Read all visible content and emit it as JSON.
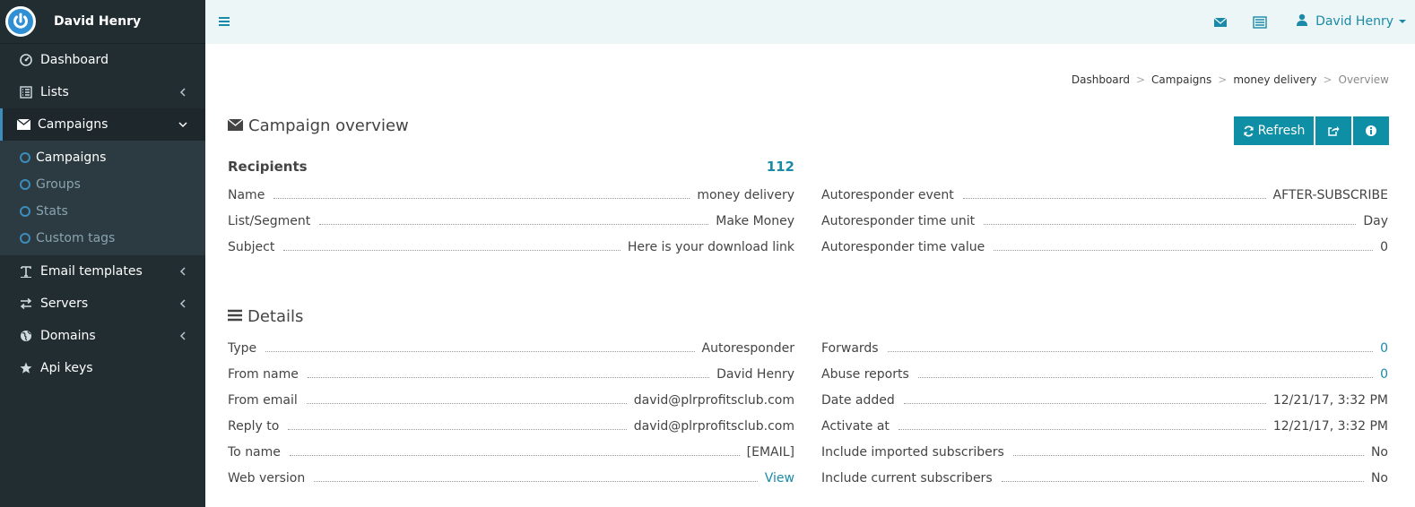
{
  "sidebar": {
    "brand_name": "David Henry",
    "items": [
      {
        "label": "Dashboard",
        "icon": "dashboard-icon"
      },
      {
        "label": "Lists",
        "icon": "list-icon"
      },
      {
        "label": "Campaigns",
        "icon": "envelope-icon"
      },
      {
        "label": "Email templates",
        "icon": "text-icon"
      },
      {
        "label": "Servers",
        "icon": "exchange-icon"
      },
      {
        "label": "Domains",
        "icon": "globe-icon"
      },
      {
        "label": "Api keys",
        "icon": "star-icon"
      }
    ],
    "campaign_submenu": [
      "Campaigns",
      "Groups",
      "Stats",
      "Custom tags"
    ]
  },
  "topbar": {
    "user_name": "David Henry"
  },
  "breadcrumb": [
    "Dashboard",
    "Campaigns",
    "money delivery",
    "Overview"
  ],
  "overview": {
    "title": "Campaign overview",
    "refresh_label": "Refresh",
    "recipients_label": "Recipients",
    "recipients_value": "112",
    "left": [
      {
        "label": "Name",
        "value": "money delivery"
      },
      {
        "label": "List/Segment",
        "value": "Make Money"
      },
      {
        "label": "Subject",
        "value": "Here is your download link"
      }
    ],
    "right": [
      {
        "label": "Autoresponder event",
        "value": "AFTER-SUBSCRIBE"
      },
      {
        "label": "Autoresponder time unit",
        "value": "Day"
      },
      {
        "label": "Autoresponder time value",
        "value": "0"
      }
    ]
  },
  "details": {
    "title": "Details",
    "left": [
      {
        "label": "Type",
        "value": "Autoresponder"
      },
      {
        "label": "From name",
        "value": "David Henry"
      },
      {
        "label": "From email",
        "value": "david@plrprofitsclub.com"
      },
      {
        "label": "Reply to",
        "value": "david@plrprofitsclub.com"
      },
      {
        "label": "To name",
        "value": "[EMAIL]"
      },
      {
        "label": "Web version",
        "value": "View"
      }
    ],
    "right": [
      {
        "label": "Forwards",
        "value": "0"
      },
      {
        "label": "Abuse reports",
        "value": "0"
      },
      {
        "label": "Date added",
        "value": "12/21/17, 3:32 PM"
      },
      {
        "label": "Activate at",
        "value": "12/21/17, 3:32 PM"
      },
      {
        "label": "Include imported subscribers",
        "value": "No"
      },
      {
        "label": "Include current subscribers",
        "value": "No"
      }
    ]
  }
}
